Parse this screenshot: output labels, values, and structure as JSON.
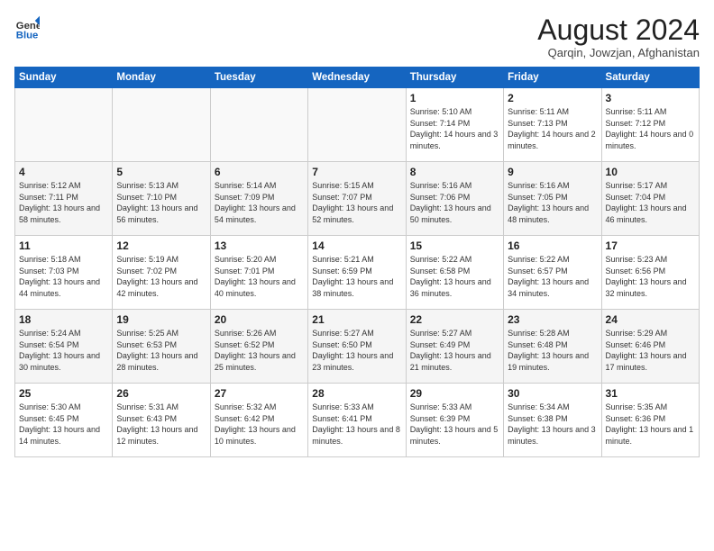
{
  "logo": {
    "line1": "General",
    "line2": "Blue"
  },
  "title": "August 2024",
  "subtitle": "Qarqin, Jowzjan, Afghanistan",
  "weekdays": [
    "Sunday",
    "Monday",
    "Tuesday",
    "Wednesday",
    "Thursday",
    "Friday",
    "Saturday"
  ],
  "weeks": [
    [
      {
        "day": "",
        "info": ""
      },
      {
        "day": "",
        "info": ""
      },
      {
        "day": "",
        "info": ""
      },
      {
        "day": "",
        "info": ""
      },
      {
        "day": "1",
        "sunrise": "5:10 AM",
        "sunset": "7:14 PM",
        "daylight": "14 hours and 3 minutes."
      },
      {
        "day": "2",
        "sunrise": "5:11 AM",
        "sunset": "7:13 PM",
        "daylight": "14 hours and 2 minutes."
      },
      {
        "day": "3",
        "sunrise": "5:11 AM",
        "sunset": "7:12 PM",
        "daylight": "14 hours and 0 minutes."
      }
    ],
    [
      {
        "day": "4",
        "sunrise": "5:12 AM",
        "sunset": "7:11 PM",
        "daylight": "13 hours and 58 minutes."
      },
      {
        "day": "5",
        "sunrise": "5:13 AM",
        "sunset": "7:10 PM",
        "daylight": "13 hours and 56 minutes."
      },
      {
        "day": "6",
        "sunrise": "5:14 AM",
        "sunset": "7:09 PM",
        "daylight": "13 hours and 54 minutes."
      },
      {
        "day": "7",
        "sunrise": "5:15 AM",
        "sunset": "7:07 PM",
        "daylight": "13 hours and 52 minutes."
      },
      {
        "day": "8",
        "sunrise": "5:16 AM",
        "sunset": "7:06 PM",
        "daylight": "13 hours and 50 minutes."
      },
      {
        "day": "9",
        "sunrise": "5:16 AM",
        "sunset": "7:05 PM",
        "daylight": "13 hours and 48 minutes."
      },
      {
        "day": "10",
        "sunrise": "5:17 AM",
        "sunset": "7:04 PM",
        "daylight": "13 hours and 46 minutes."
      }
    ],
    [
      {
        "day": "11",
        "sunrise": "5:18 AM",
        "sunset": "7:03 PM",
        "daylight": "13 hours and 44 minutes."
      },
      {
        "day": "12",
        "sunrise": "5:19 AM",
        "sunset": "7:02 PM",
        "daylight": "13 hours and 42 minutes."
      },
      {
        "day": "13",
        "sunrise": "5:20 AM",
        "sunset": "7:01 PM",
        "daylight": "13 hours and 40 minutes."
      },
      {
        "day": "14",
        "sunrise": "5:21 AM",
        "sunset": "6:59 PM",
        "daylight": "13 hours and 38 minutes."
      },
      {
        "day": "15",
        "sunrise": "5:22 AM",
        "sunset": "6:58 PM",
        "daylight": "13 hours and 36 minutes."
      },
      {
        "day": "16",
        "sunrise": "5:22 AM",
        "sunset": "6:57 PM",
        "daylight": "13 hours and 34 minutes."
      },
      {
        "day": "17",
        "sunrise": "5:23 AM",
        "sunset": "6:56 PM",
        "daylight": "13 hours and 32 minutes."
      }
    ],
    [
      {
        "day": "18",
        "sunrise": "5:24 AM",
        "sunset": "6:54 PM",
        "daylight": "13 hours and 30 minutes."
      },
      {
        "day": "19",
        "sunrise": "5:25 AM",
        "sunset": "6:53 PM",
        "daylight": "13 hours and 28 minutes."
      },
      {
        "day": "20",
        "sunrise": "5:26 AM",
        "sunset": "6:52 PM",
        "daylight": "13 hours and 25 minutes."
      },
      {
        "day": "21",
        "sunrise": "5:27 AM",
        "sunset": "6:50 PM",
        "daylight": "13 hours and 23 minutes."
      },
      {
        "day": "22",
        "sunrise": "5:27 AM",
        "sunset": "6:49 PM",
        "daylight": "13 hours and 21 minutes."
      },
      {
        "day": "23",
        "sunrise": "5:28 AM",
        "sunset": "6:48 PM",
        "daylight": "13 hours and 19 minutes."
      },
      {
        "day": "24",
        "sunrise": "5:29 AM",
        "sunset": "6:46 PM",
        "daylight": "13 hours and 17 minutes."
      }
    ],
    [
      {
        "day": "25",
        "sunrise": "5:30 AM",
        "sunset": "6:45 PM",
        "daylight": "13 hours and 14 minutes."
      },
      {
        "day": "26",
        "sunrise": "5:31 AM",
        "sunset": "6:43 PM",
        "daylight": "13 hours and 12 minutes."
      },
      {
        "day": "27",
        "sunrise": "5:32 AM",
        "sunset": "6:42 PM",
        "daylight": "13 hours and 10 minutes."
      },
      {
        "day": "28",
        "sunrise": "5:33 AM",
        "sunset": "6:41 PM",
        "daylight": "13 hours and 8 minutes."
      },
      {
        "day": "29",
        "sunrise": "5:33 AM",
        "sunset": "6:39 PM",
        "daylight": "13 hours and 5 minutes."
      },
      {
        "day": "30",
        "sunrise": "5:34 AM",
        "sunset": "6:38 PM",
        "daylight": "13 hours and 3 minutes."
      },
      {
        "day": "31",
        "sunrise": "5:35 AM",
        "sunset": "6:36 PM",
        "daylight": "13 hours and 1 minute."
      }
    ]
  ],
  "labels": {
    "sunrise": "Sunrise:",
    "sunset": "Sunset:",
    "daylight": "Daylight:"
  }
}
